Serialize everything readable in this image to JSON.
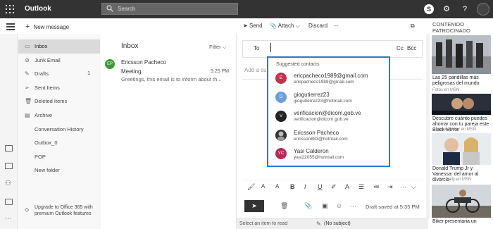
{
  "topbar": {
    "brand": "Outlook",
    "search_placeholder": "Search",
    "skype_glyph": "S"
  },
  "nav": {
    "new_message": "New message"
  },
  "folders": [
    {
      "label": "Inbox",
      "icon": "inbox-icon",
      "count": ""
    },
    {
      "label": "Junk Email",
      "icon": "junk-icon",
      "count": ""
    },
    {
      "label": "Drafts",
      "icon": "pencil-icon",
      "count": "1"
    },
    {
      "label": "Sent Items",
      "icon": "send-icon",
      "count": ""
    },
    {
      "label": "Deleted Items",
      "icon": "trash-icon",
      "count": ""
    },
    {
      "label": "Archive",
      "icon": "archive-icon",
      "count": ""
    },
    {
      "label": "Conversation History",
      "icon": "",
      "count": ""
    },
    {
      "label": "Outbox_0",
      "icon": "",
      "count": ""
    },
    {
      "label": "POP",
      "icon": "",
      "count": ""
    },
    {
      "label": "New folder",
      "icon": "",
      "count": ""
    }
  ],
  "upgrade": "Upgrade to Office 365 with premium Outlook features",
  "list": {
    "title": "Inbox",
    "filter": "Filter",
    "message": {
      "initials": "EP",
      "from": "Ericsson Pacheco",
      "subject": "Meeting",
      "time": "5:25 PM",
      "preview": "Greetings, this email is to inform about th..."
    }
  },
  "toolbar": {
    "send": "Send",
    "attach": "Attach",
    "discard": "Discard",
    "more": "···"
  },
  "compose": {
    "to_label": "To",
    "cc": "Cc",
    "bcc": "Bcc",
    "subject_placeholder": "Add a subject",
    "saved": "Draft saved at 5:35 PM"
  },
  "suggestions": {
    "title": "Suggested contacts",
    "contacts": [
      {
        "initials": "E",
        "color": "#c4314b",
        "name": "ericpacheco1989@gmail.com",
        "email": "ericpacheco1989@gmail.com"
      },
      {
        "initials": "G",
        "color": "#6a9fd8",
        "name": "giogutierrez23",
        "email": "giogutierrez23@hotmail.com"
      },
      {
        "initials": "V",
        "color": "#222222",
        "name": "verificacion@dicom.gob.ve",
        "email": "verificacion@dicom.gob.ve"
      },
      {
        "initials": "",
        "color": "#555555",
        "name": "Ericsson Pacheco",
        "email": "ericsson883@hotmail.com"
      },
      {
        "initials": "YC",
        "color": "#b52b55",
        "name": "Yasi Calderon",
        "email": "yasi22055@hotmail.com"
      }
    ]
  },
  "status": {
    "left": "Select an item to read",
    "right": "(No subject)"
  },
  "ads": {
    "title": "CONTENIDO PATROCINADO",
    "items": [
      {
        "title": "Las 25 pandillas más peligrosas del mundo",
        "source": "Fotos en MSN"
      },
      {
        "title": "Descubre cuánto puedes ahorrar con tu pareja este Black Mirror",
        "source": "Computer Hoy en MSN"
      },
      {
        "title": "Donald Trump Jr y Vanessa: del amor al divorcio",
        "source": "Stellar Daily en MSN"
      },
      {
        "title": "Biker presentaria un",
        "source": ""
      }
    ]
  }
}
